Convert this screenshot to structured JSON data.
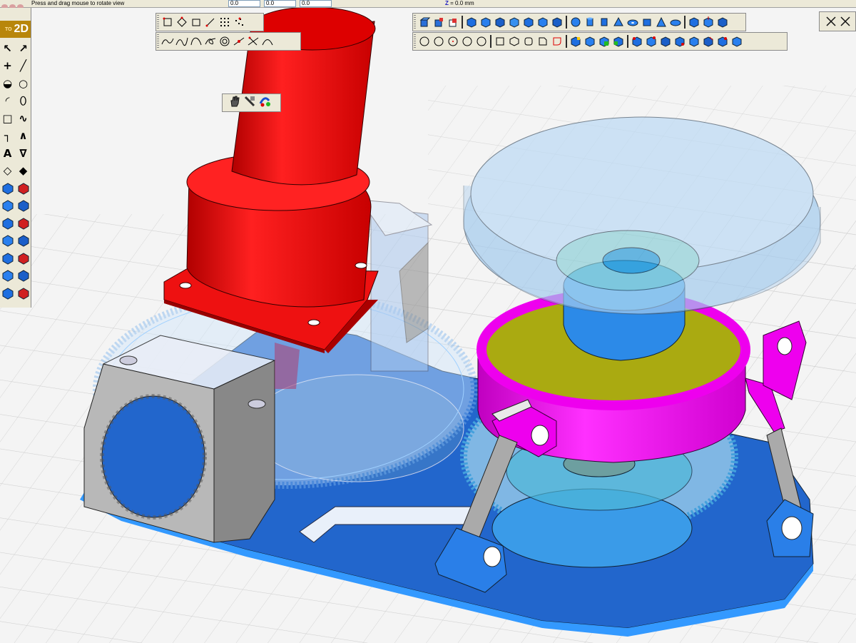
{
  "app": {
    "status_hint": "Press and drag mouse to rotate view",
    "coord_fields": [
      "0.0",
      "0.0",
      "0.0"
    ],
    "z_label": "Z",
    "z_value": "= 0.0 mm",
    "logo_small": "TO",
    "logo_text": "2D"
  },
  "toolbars": {
    "selection": {
      "name": "selection-tools",
      "buttons": 7
    },
    "curves": {
      "name": "curve-tools",
      "buttons": 9
    },
    "solids_top": {
      "name": "solid-primitives",
      "groups": [
        3,
        7,
        8,
        4
      ]
    },
    "sketch_shapes": {
      "name": "sketch-shapes",
      "groups": [
        5,
        5,
        4,
        9
      ]
    },
    "view_hand": {
      "name": "view-tools",
      "buttons": [
        "pan-icon",
        "zoom-window-icon",
        "rotate-view-icon"
      ]
    }
  },
  "palette": {
    "items": [
      "arrow-select-icon",
      "pointer-icon",
      "point-icon",
      "line-icon",
      "arc-icon",
      "circle-icon",
      "arc2-icon",
      "ellipse-icon",
      "rectangle-icon",
      "spline-icon",
      "polyline-icon",
      "chamfer-icon",
      "text-icon",
      "dimension-icon",
      "snap-icon",
      "snap2-icon",
      "add-solid-icon",
      "person-icon",
      "extrude-icon",
      "revolve-icon",
      "cut-icon",
      "cube-icon",
      "boolean-icon",
      "shell-icon",
      "light-icon",
      "grid-view-icon",
      "orbit-icon",
      "zoom-icon",
      "iso-view-icon",
      "front-view-icon"
    ]
  },
  "colors": {
    "motor": "#ee1111",
    "motor_dark": "#b00000",
    "base_plate": "#2277dd",
    "base_edge": "#3399ff",
    "bracket_gray": "#b8b8b8",
    "turntable_magenta": "#ee00ee",
    "olive": "#aaaa11",
    "glass": "#9ec8ee",
    "grid_bg": "#f4f4f4",
    "toolbar_bg": "#ece9d8"
  },
  "window": {
    "close_icon": "close-icon",
    "restore_icon": "restore-icon"
  }
}
